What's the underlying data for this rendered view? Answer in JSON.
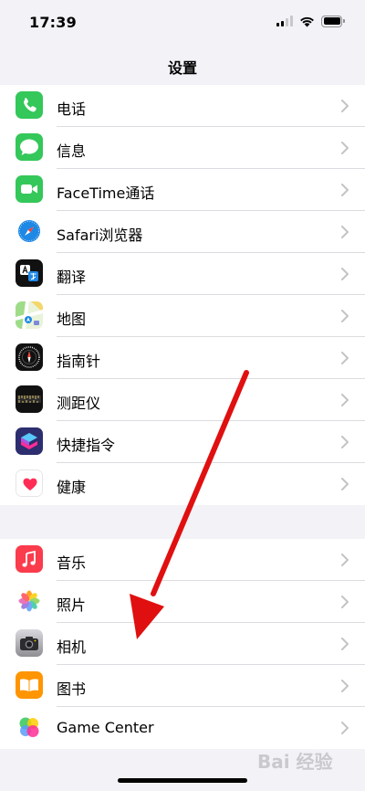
{
  "status_bar": {
    "time": "17:39",
    "icons": [
      "signal-icon",
      "wifi-icon",
      "battery-icon"
    ]
  },
  "nav": {
    "title": "设置"
  },
  "groups": [
    {
      "items": [
        {
          "label": "电话",
          "icon": "phone-icon",
          "color": "#34c759"
        },
        {
          "label": "信息",
          "icon": "messages-icon",
          "color": "#34c759"
        },
        {
          "label": "FaceTime通话",
          "icon": "facetime-icon",
          "color": "#34c759"
        },
        {
          "label": "Safari浏览器",
          "icon": "safari-icon",
          "color": "#1e88e5"
        },
        {
          "label": "翻译",
          "icon": "translate-icon",
          "color": "#111111"
        },
        {
          "label": "地图",
          "icon": "maps-icon",
          "color": "#7ed17e"
        },
        {
          "label": "指南针",
          "icon": "compass-icon",
          "color": "#111111"
        },
        {
          "label": "测距仪",
          "icon": "measure-icon",
          "color": "#111111"
        },
        {
          "label": "快捷指令",
          "icon": "shortcuts-icon",
          "color": "#3d3fb8"
        },
        {
          "label": "健康",
          "icon": "health-icon",
          "color": "#ff2d55"
        }
      ]
    },
    {
      "items": [
        {
          "label": "音乐",
          "icon": "music-icon",
          "color": "#fa3c4c"
        },
        {
          "label": "照片",
          "icon": "photos-icon",
          "color": "#ffffff"
        },
        {
          "label": "相机",
          "icon": "camera-icon",
          "color": "#8e8e93"
        },
        {
          "label": "图书",
          "icon": "books-icon",
          "color": "#ff9500"
        },
        {
          "label": "Game Center",
          "icon": "game-center-icon",
          "color": "#ffffff"
        }
      ]
    }
  ],
  "watermark": "Bai 经验",
  "annotation_color": "#e01010"
}
